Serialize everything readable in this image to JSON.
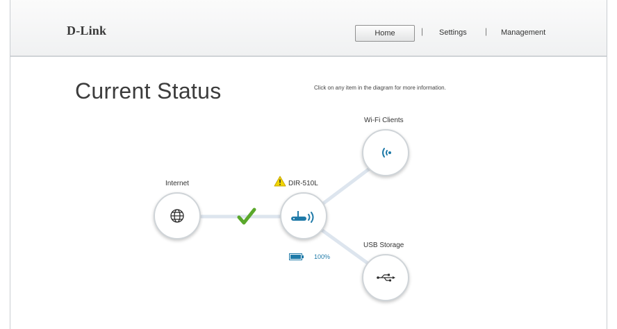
{
  "brand": {
    "logo": "D-Link"
  },
  "nav": {
    "home": "Home",
    "separator": "|",
    "settings": "Settings",
    "management": "Management",
    "active": "Home"
  },
  "page": {
    "title": "Current Status",
    "hint": "Click on any item in the diagram for more information."
  },
  "diagram": {
    "internet": {
      "label": "Internet",
      "icon": "globe-icon",
      "status": "connected",
      "status_icon": "checkmark-icon"
    },
    "router": {
      "label": "DIR-510L",
      "icon": "router-icon",
      "warning_icon": "warning-icon",
      "battery_icon": "battery-icon",
      "battery": "100%"
    },
    "wifi_clients": {
      "label": "Wi-Fi Clients",
      "icon": "wifi-signal-icon"
    },
    "usb_storage": {
      "label": "USB Storage",
      "icon": "usb-icon"
    }
  },
  "colors": {
    "accent": "#1f7aa8",
    "check": "#5aa82b",
    "warning": "#f2d600",
    "link_line": "#dde5ee"
  }
}
